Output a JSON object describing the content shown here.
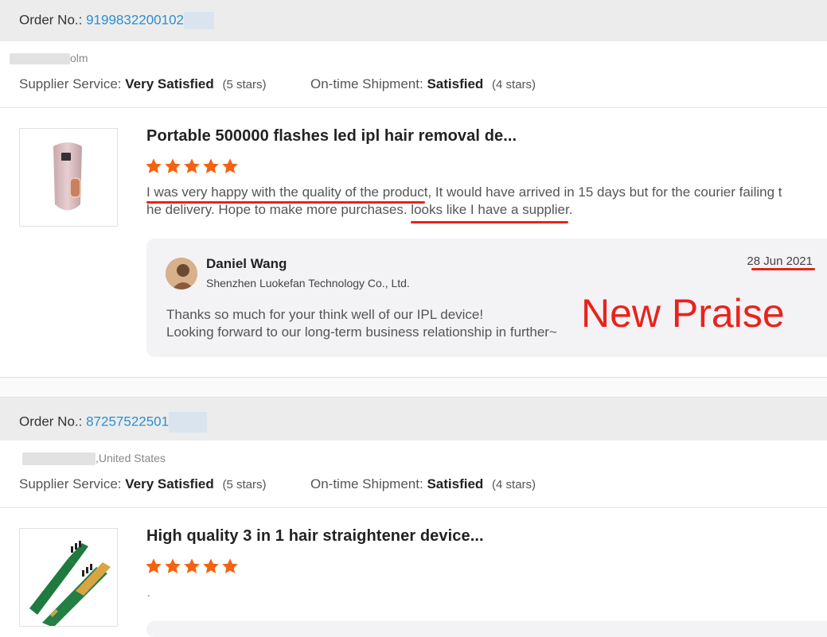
{
  "orders": [
    {
      "order_label": "Order No.:",
      "order_number": "9199832200102",
      "location_suffix": "olm",
      "supplier_service_label": "Supplier Service:",
      "supplier_service_value": "Very Satisfied",
      "supplier_service_stars": "(5 stars)",
      "shipment_label": "On-time Shipment:",
      "shipment_value": "Satisfied",
      "shipment_stars": "(4 stars)",
      "product_title": "Portable 500000 flashes led ipl hair removal de...",
      "rating": 5,
      "review_text": "I was very happy with the quality of the product, It would have arrived in 15 days but for the courier failing t he delivery. Hope to make more purchases. looks like I have a supplier.",
      "reply": {
        "name": "Daniel Wang",
        "company": "Shenzhen Luokefan Technology Co., Ltd.",
        "date": "28 Jun 2021",
        "line1": "Thanks so much for your think well of our IPL device!",
        "line2": "Looking forward to our long-term business relationship in further~"
      }
    },
    {
      "order_label": "Order No.:",
      "order_number": "87257522501",
      "location_suffix": ",United States",
      "supplier_service_label": "Supplier Service:",
      "supplier_service_value": "Very Satisfied",
      "supplier_service_stars": "(5 stars)",
      "shipment_label": "On-time Shipment:",
      "shipment_value": "Satisfied",
      "shipment_stars": "(4 stars)",
      "product_title": "High quality 3 in 1 hair straightener device...",
      "rating": 5,
      "review_text": "."
    }
  ],
  "annotation": "New Praise",
  "colors": {
    "accent_link": "#2a8fd1",
    "star": "#f5620f",
    "annotation_red": "#e8231c"
  },
  "icons": [
    "star-icon",
    "avatar"
  ]
}
